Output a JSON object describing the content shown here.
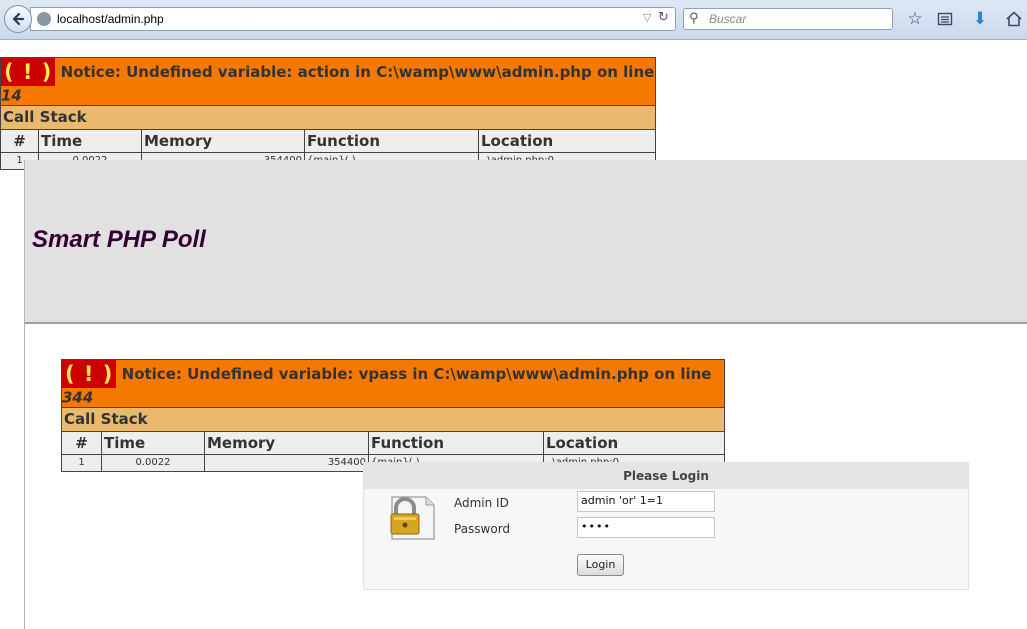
{
  "browser": {
    "url": "localhost/admin.php",
    "search_placeholder": "Buscar"
  },
  "notice1": {
    "icon": "( ! )",
    "text": "Notice: Undefined variable: action in C:\\wamp\\www\\admin.php on line ",
    "line": "14",
    "call_stack": "Call Stack",
    "columns": [
      "#",
      "Time",
      "Memory",
      "Function",
      "Location"
    ],
    "row": {
      "num": "1",
      "time": "0.0022",
      "memory": "354400",
      "function": "{main}( )",
      "location": "..\\admin.php:0"
    }
  },
  "app_title": "Smart PHP Poll",
  "notice2": {
    "icon": "( ! )",
    "text": "Notice: Undefined variable: vpass in C:\\wamp\\www\\admin.php on line ",
    "line": "344",
    "call_stack": "Call Stack",
    "columns": [
      "#",
      "Time",
      "Memory",
      "Function",
      "Location"
    ],
    "row": {
      "num": "1",
      "time": "0.0022",
      "memory": "354400",
      "function": "{main}( )",
      "location": "..\\admin.php:0"
    }
  },
  "login": {
    "title": "Please Login",
    "admin_id_label": "Admin ID",
    "admin_id_value": "admin 'or' 1=1",
    "password_label": "Password",
    "password_value": "••••",
    "button": "Login"
  },
  "colors": {
    "notice_orange": "#f57900",
    "callstack_tan": "#e9b96e",
    "error_red": "#cc0000",
    "title_purple": "#330033"
  }
}
